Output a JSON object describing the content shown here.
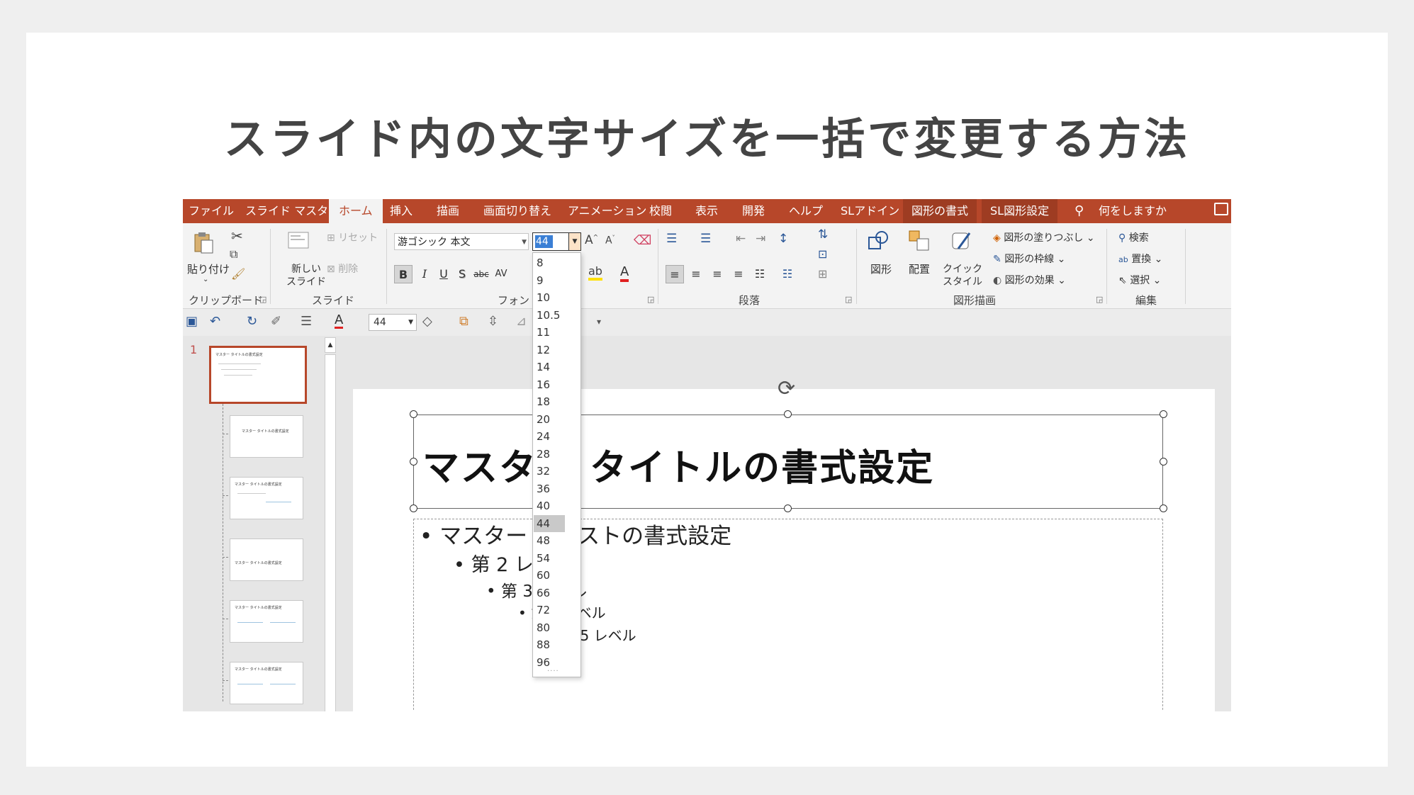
{
  "page": {
    "title": "スライド内の文字サイズを一括で変更する方法"
  },
  "tabs": [
    "ファイル",
    "スライド マスター",
    "ホーム",
    "挿入",
    "描画",
    "画面切り替え",
    "アニメーション",
    "校閲",
    "表示",
    "開発",
    "ヘルプ",
    "SLアドイン",
    "図形の書式",
    "SL図形設定"
  ],
  "active_tab": "ホーム",
  "tell_me": "何をしますか",
  "ribbon": {
    "clipboard": {
      "paste": "貼り付け",
      "label": "クリップボード"
    },
    "slides": {
      "new_slide": "新しい\nスライド",
      "reset": "リセット",
      "delete": "削除",
      "label": "スライド"
    },
    "font": {
      "name": "游ゴシック 本文",
      "size": "44",
      "label": "フォント"
    },
    "paragraph": {
      "label": "段落"
    },
    "drawing": {
      "shapes": "図形",
      "arrange": "配置",
      "quick_styles": "クイック\nスタイル",
      "fill": "図形の塗りつぶし",
      "outline": "図形の枠線",
      "effects": "図形の効果",
      "label": "図形描画"
    },
    "editing": {
      "find": "検索",
      "replace": "置換",
      "select": "選択",
      "label": "編集"
    }
  },
  "qat": {
    "font_size": "44"
  },
  "font_size_options": [
    "8",
    "9",
    "10",
    "10.5",
    "11",
    "12",
    "14",
    "16",
    "18",
    "20",
    "24",
    "28",
    "32",
    "36",
    "40",
    "44",
    "48",
    "54",
    "60",
    "66",
    "72",
    "80",
    "88",
    "96"
  ],
  "selected_size": "44",
  "slide_number": "1",
  "thumbnails": [
    "マスター タイトルの書式設定",
    "マスター タイトルの書式設定",
    "マスター タイトルの書式設定",
    "マスター タイトルの書式設定",
    "マスター タイトルの書式設定",
    "マスター タイトルの書式設定"
  ],
  "slide": {
    "title": "マスター タイトルの書式設定",
    "body": [
      "マスター テキストの書式設定",
      "第 2 レベル",
      "第 3 レベル",
      "第 4 レベル",
      "第 5 レベル"
    ]
  }
}
